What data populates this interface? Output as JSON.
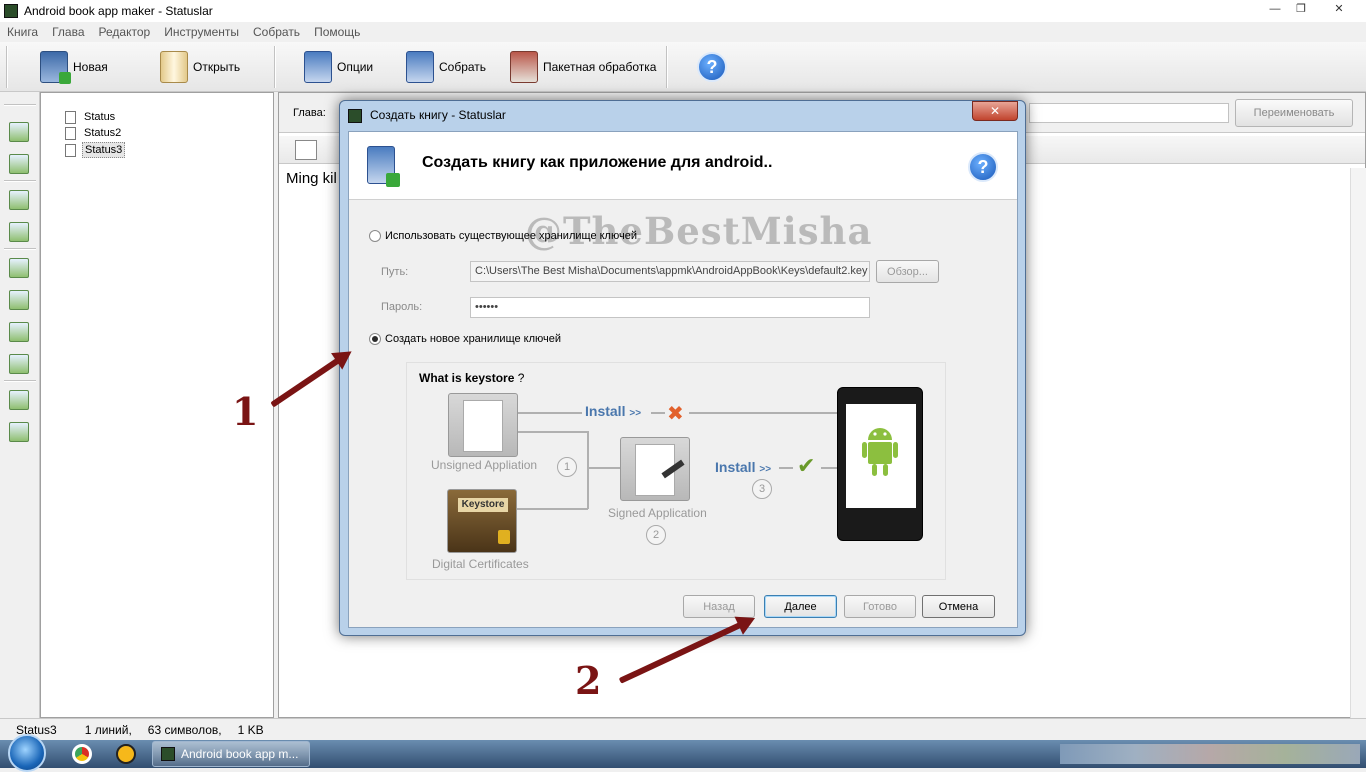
{
  "window": {
    "title": "Android book app maker - Statuslar"
  },
  "menu": [
    "Книга",
    "Глава",
    "Редактор",
    "Инструменты",
    "Собрать",
    "Помощь"
  ],
  "toolbar": {
    "new_label": "Новая",
    "open_label": "Открыть",
    "options_label": "Опции",
    "build_label": "Собрать",
    "batch_label": "Пакетная обработка"
  },
  "tree": {
    "items": [
      "Status",
      "Status2",
      "Status3"
    ],
    "selected": "Status3"
  },
  "chapter": {
    "label": "Глава:",
    "rename_label": "Переименовать"
  },
  "editor": {
    "text": "Ming kil"
  },
  "status": {
    "chapter": "Status3",
    "lines": "1 линий,",
    "chars": "63 символов,",
    "size": "1 KB"
  },
  "taskbar": {
    "app_label": "Android book app m..."
  },
  "dialog": {
    "title": "Создать книгу - Statuslar",
    "heading": "Создать книгу как приложение для android..",
    "watermark": "@TheBestMisha",
    "use_existing_label": "Использовать существующее хранилище ключей",
    "path_label": "Путь:",
    "path_value": "C:\\Users\\The Best Misha\\Documents\\appmk\\AndroidAppBook\\Keys\\default2.key",
    "browse_label": "Обзор...",
    "password_label": "Пароль:",
    "password_value": "••••••",
    "create_new_label": "Создать новое хранилище ключей",
    "create_new_selected": true,
    "back_label": "Назад",
    "next_label": "Далее",
    "done_label": "Готово",
    "cancel_label": "Отмена"
  },
  "diagram": {
    "title": "What is keystore",
    "title_mark": "?",
    "unsigned": "Unsigned Appliation",
    "digital": "Digital Certificates",
    "keystore_label": "Keystore",
    "signed": "Signed Application",
    "install": "Install",
    "install_arrows": ">>",
    "steps": [
      "1",
      "2",
      "3"
    ]
  },
  "annotations": {
    "label1": "1",
    "label2": "2"
  },
  "colors": {
    "annotation": "#7a1414",
    "install_text": "#4a77ad",
    "android_green": "#8cbf3f"
  }
}
